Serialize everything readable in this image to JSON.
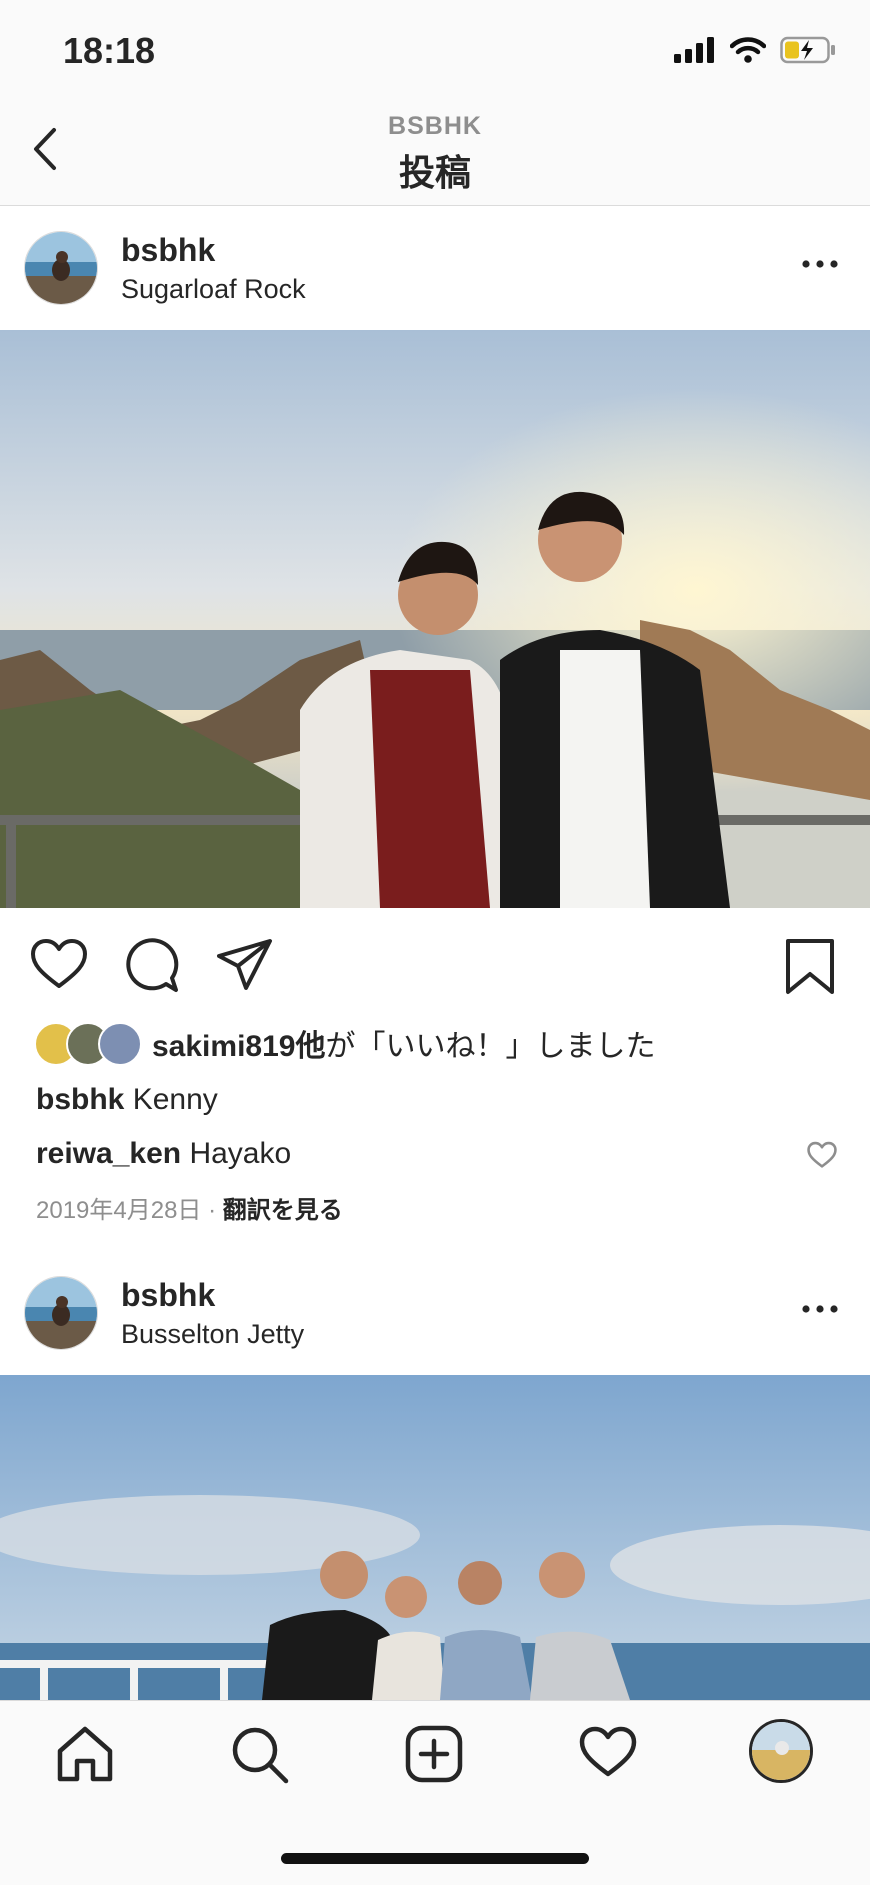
{
  "status_bar": {
    "time": "18:18"
  },
  "header": {
    "account": "BSBHK",
    "title": "投稿"
  },
  "posts": [
    {
      "username": "bsbhk",
      "location": "Sugarloaf Rock"
    },
    {
      "username": "bsbhk",
      "location": "Busselton Jetty"
    }
  ],
  "likes": {
    "user": "sakimi819他",
    "suffix": "が「いいね！」しました"
  },
  "caption": {
    "username": "bsbhk",
    "text": "Kenny"
  },
  "comment": {
    "username": "reiwa_ken",
    "text": "Hayako"
  },
  "meta": {
    "date": "2019年4月28日",
    "separator": "·",
    "translate": "翻訳を見る"
  },
  "colors": {
    "text": "#262626",
    "secondary": "#8e8e8e",
    "divider": "#dbdbdb",
    "bar_bg": "#fafafa"
  },
  "icons": [
    "back-icon",
    "more-icon",
    "heart-icon",
    "comment-icon",
    "share-icon",
    "bookmark-icon",
    "home-icon",
    "search-icon",
    "add-post-icon",
    "activity-icon",
    "profile-icon"
  ]
}
